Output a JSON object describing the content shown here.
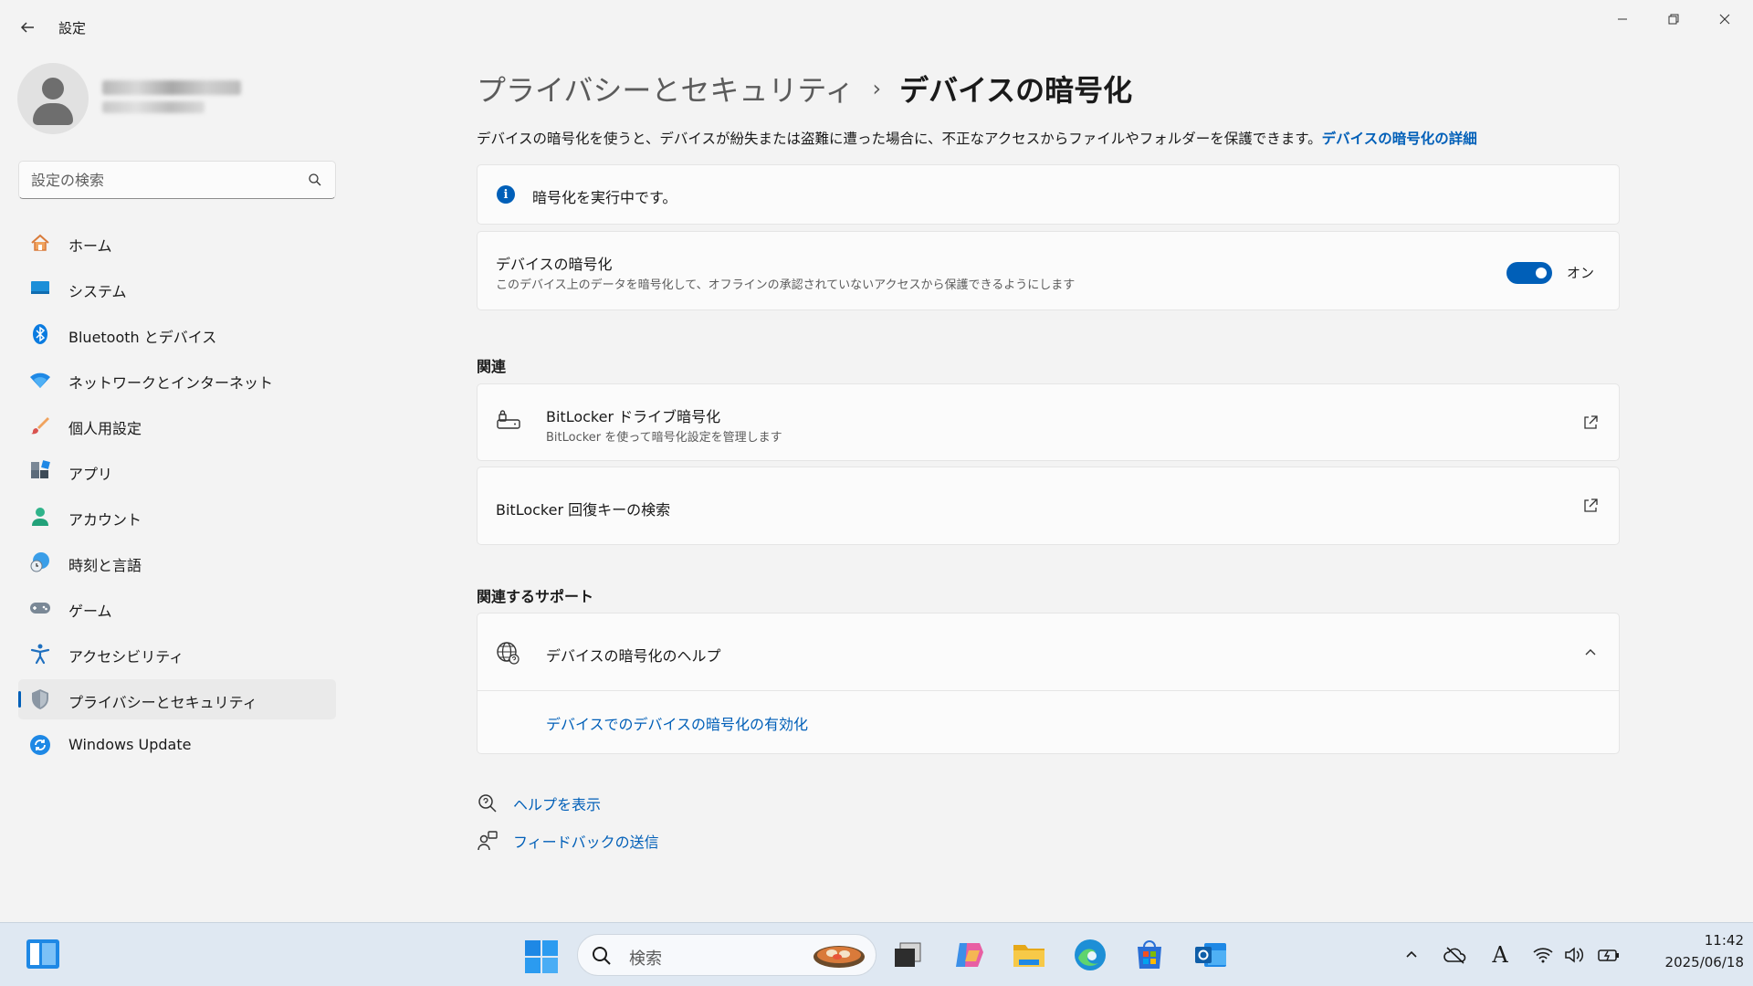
{
  "window": {
    "title": "設定",
    "controls": {
      "minimize": "minimize-icon",
      "maximize": "restore-icon",
      "close": "close-icon"
    }
  },
  "sidebar": {
    "search_placeholder": "設定の検索",
    "items": [
      {
        "label": "ホーム",
        "icon": "home-icon"
      },
      {
        "label": "システム",
        "icon": "system-icon"
      },
      {
        "label": "Bluetooth とデバイス",
        "icon": "bluetooth-icon"
      },
      {
        "label": "ネットワークとインターネット",
        "icon": "wifi-icon"
      },
      {
        "label": "個人用設定",
        "icon": "brush-icon"
      },
      {
        "label": "アプリ",
        "icon": "apps-icon"
      },
      {
        "label": "アカウント",
        "icon": "account-icon"
      },
      {
        "label": "時刻と言語",
        "icon": "time-language-icon"
      },
      {
        "label": "ゲーム",
        "icon": "gamepad-icon"
      },
      {
        "label": "アクセシビリティ",
        "icon": "accessibility-icon"
      },
      {
        "label": "プライバシーとセキュリティ",
        "icon": "shield-icon",
        "selected": true
      },
      {
        "label": "Windows Update",
        "icon": "update-icon"
      }
    ]
  },
  "main": {
    "breadcrumb_parent": "プライバシーとセキュリティ",
    "breadcrumb_sep": "›",
    "breadcrumb_current": "デバイスの暗号化",
    "description": "デバイスの暗号化を使うと、デバイスが紛失または盗難に遭った場合に、不正なアクセスからファイルやフォルダーを保護できます。",
    "description_link": "デバイスの暗号化の詳細",
    "info_message": "暗号化を実行中です。",
    "encryption": {
      "title": "デバイスの暗号化",
      "subtitle": "このデバイス上のデータを暗号化して、オフラインの承認されていないアクセスから保護できるようにします",
      "toggle_on": true,
      "toggle_label": "オン"
    },
    "related_title": "関連",
    "bitlocker": {
      "title": "BitLocker ドライブ暗号化",
      "subtitle": "BitLocker を使って暗号化設定を管理します"
    },
    "recovery_key": {
      "title": "BitLocker 回復キーの検索"
    },
    "support_title": "関連するサポート",
    "help": {
      "title": "デバイスの暗号化のヘルプ",
      "link": "デバイスでのデバイスの暗号化の有効化",
      "expanded": true
    },
    "footer": {
      "get_help": "ヘルプを表示",
      "feedback": "フィードバックの送信"
    }
  },
  "taskbar": {
    "search_placeholder": "検索",
    "apps": [
      "start-icon",
      "task-view-icon",
      "copilot-icon",
      "file-explorer-icon",
      "edge-icon",
      "store-icon",
      "outlook-icon"
    ],
    "tray": [
      "chevron-up-icon",
      "onedrive-icon",
      "ime-icon",
      "wifi-icon",
      "volume-icon",
      "battery-icon"
    ],
    "ime_label": "A",
    "time": "11:42",
    "date": "2025/06/18"
  }
}
